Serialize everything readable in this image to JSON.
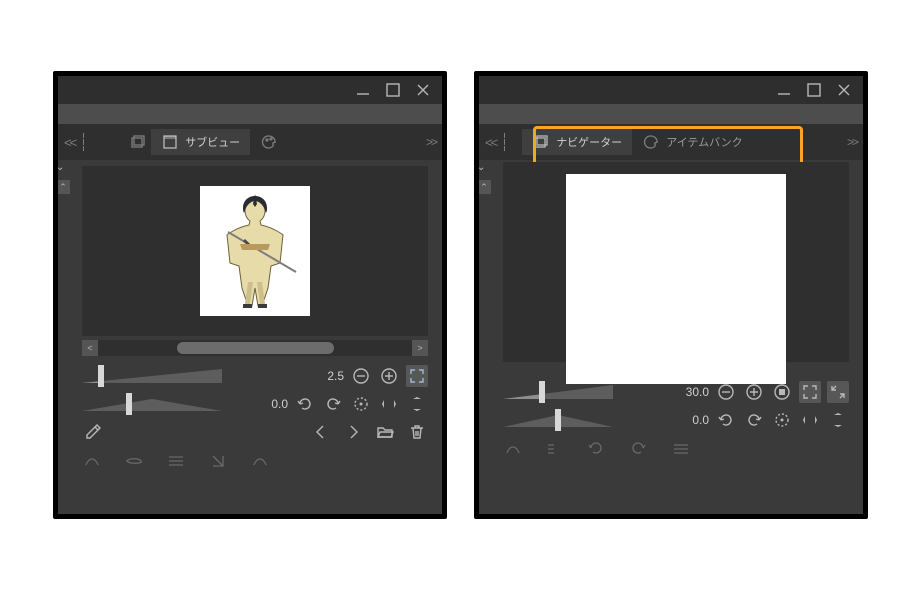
{
  "left": {
    "tabs": {
      "active_label": "サブビュー",
      "inactive_icon": "palette"
    },
    "zoom_value": "2.5",
    "rotate_value": "0.0"
  },
  "right": {
    "tabs": {
      "active_label": "ナビゲーター",
      "inactive_label": "アイテムバンク"
    },
    "zoom_value": "30.0",
    "rotate_value": "0.0"
  }
}
